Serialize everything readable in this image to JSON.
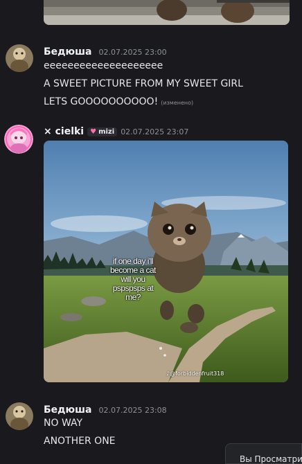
{
  "messages": [
    {
      "user": "Бедюша",
      "time": "02.07.2025 23:00",
      "lines": [
        "eeeeeeeeeeeeeeeeeeee",
        "A SWEET PICTURE FROM MY SWEET GIRL",
        "LETS GOOOOOOOOOO!"
      ],
      "edited_label": "(изменено)"
    },
    {
      "user": "× cielki",
      "tag": "mizi",
      "time": "02.07.2025 23:07",
      "image": {
        "caption": "if one day i'll become a cat will you pspspsps at me?",
        "watermark": "@forbiddenfruit318"
      }
    },
    {
      "user": "Бедюша",
      "time": "02.07.2025 23:08",
      "lines": [
        "NO WAY",
        "ANOTHER ONE"
      ]
    }
  ],
  "tooltip": {
    "label": "Вы Просматри"
  },
  "icons": {
    "tag_icon": "heart-icon",
    "watermark_icon": "tiktok-icon"
  },
  "colors": {
    "background": "#1a1a1e",
    "tag_heart": "#ff6fae"
  }
}
